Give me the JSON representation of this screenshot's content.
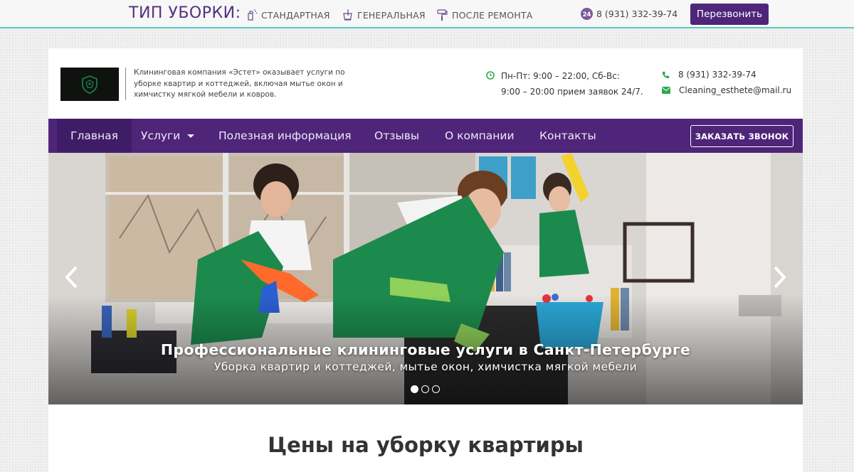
{
  "topbar": {
    "type_title": "ТИП УБОРКИ:",
    "types": [
      {
        "label": "СТАНДАРТНАЯ",
        "icon": "spray-icon"
      },
      {
        "label": "ГЕНЕРАЛЬНАЯ",
        "icon": "bucket-icon"
      },
      {
        "label": "ПОСЛЕ РЕМОНТА",
        "icon": "paint-roller-icon"
      }
    ],
    "phone": "8 (931) 332-39-74",
    "phone_icon": "phone-24-icon",
    "callback_label": "Перезвонить"
  },
  "header": {
    "description": "Клининговая компания «Эстет» оказывает услуги по уборке квартир и коттеджей, включая мытье окон и химчистку мягкой мебели и ковров.",
    "hours_line1": "Пн-Пт: 9:00 – 22:00, Сб-Вс:",
    "hours_line2": "9:00 – 20:00 прием заявок 24/7.",
    "phone": "8 (931) 332-39-74",
    "email": "Cleaning_esthete@mail.ru"
  },
  "nav": {
    "items": [
      {
        "label": "Главная"
      },
      {
        "label": "Услуги"
      },
      {
        "label": "Полезная информация"
      },
      {
        "label": "Отзывы"
      },
      {
        "label": "О компании"
      },
      {
        "label": "Контакты"
      }
    ],
    "order_label": "ЗАКАЗАТЬ ЗВОНОК"
  },
  "hero": {
    "title": "Профессиональные клининговые услуги в Санкт-Петербурге",
    "subtitle": "Уборка квартир и коттеджей, мытье окон, химчистка мягкой мебели",
    "slides_total": 3,
    "active_slide": 1
  },
  "main": {
    "section_title": "Цены на уборку квартиры"
  },
  "colors": {
    "brand_purple": "#4e2579",
    "active_nav": "#3f1d66",
    "accent_green": "#2fa84f",
    "topbar_line": "#5cc7c2"
  }
}
